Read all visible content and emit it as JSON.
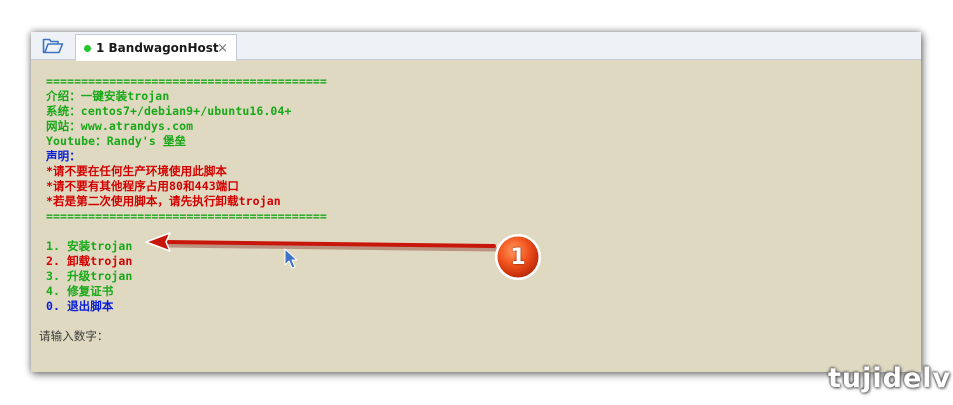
{
  "tab": {
    "title": "1 BandwagonHost",
    "close": "×",
    "status_color": "#22c52b"
  },
  "icons": {
    "open_folder": "open-folder-icon",
    "cursor": "mouse-cursor-icon",
    "arrow": "red-arrow",
    "badge": "step-number-badge"
  },
  "terminal": {
    "separator_top": "========================================",
    "intro": "介绍：一键安装trojan",
    "system": "系统：centos7+/debian9+/ubuntu16.04+",
    "website": "网站：www.atrandys.com",
    "youtube": "Youtube：Randy's 堡垒",
    "notice_title": "声明：",
    "notice_1": "*请不要在任何生产环境使用此脚本",
    "notice_2": "*请不要有其他程序占用80和443端口",
    "notice_3": "*若是第二次使用脚本，请先执行卸载trojan",
    "separator_bottom": "========================================",
    "menu": [
      "1. 安装trojan",
      "2. 卸载trojan",
      "3. 升级trojan",
      "4. 修复证书",
      "0. 退出脚本"
    ],
    "prompt": "请输入数字："
  },
  "annotation": {
    "badge_number": "1"
  },
  "watermark": "tujidelv",
  "colors": {
    "terminal_bg": "#dfd9c1",
    "green": "#18a818",
    "red": "#d40000",
    "blue": "#0a1ed8",
    "annotation_red": "#c8170a"
  }
}
